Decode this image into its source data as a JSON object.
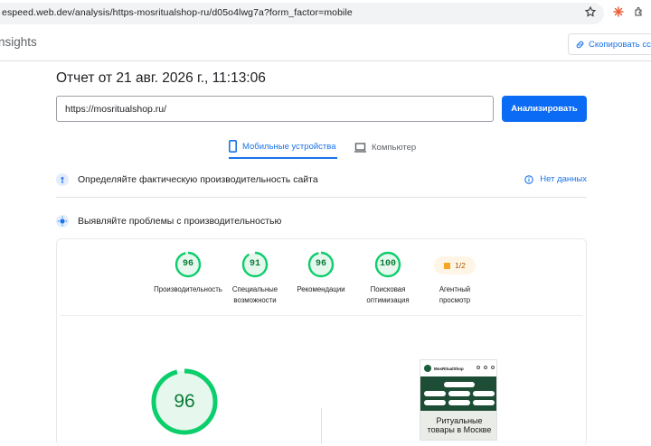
{
  "browser": {
    "url": "espeed.web.dev/analysis/https-mosritualshop-ru/d05o4lwg7a?form_factor=mobile"
  },
  "header": {
    "brand": "nsights",
    "copy_link_label": "Скопировать ссыл"
  },
  "report": {
    "title": "Отчет от 21 авг. 2026 г., 11:13:06",
    "url_value": "https://mosritualshop.ru/",
    "analyze_label": "Анализировать"
  },
  "tabs": [
    {
      "label": "Мобильные устройства",
      "active": true
    },
    {
      "label": "Компьютер",
      "active": false
    }
  ],
  "field_data": {
    "title": "Определяйте фактическую производительность сайта",
    "status": "Нет данных"
  },
  "lab_data": {
    "title": "Выявляйте проблемы с производительностью"
  },
  "scores": [
    {
      "value": "96",
      "label_line1": "Производительность",
      "label_line2": "",
      "fraction": 0.96
    },
    {
      "value": "91",
      "label_line1": "Специальные",
      "label_line2": "возможности",
      "fraction": 0.91
    },
    {
      "value": "96",
      "label_line1": "Рекомендации",
      "label_line2": "",
      "fraction": 0.96
    },
    {
      "value": "100",
      "label_line1": "Поисковая",
      "label_line2": "оптимизация",
      "fraction": 1.0
    }
  ],
  "pwa": {
    "value": "1/2",
    "label_line1": "Агентный",
    "label_line2": "просмотр"
  },
  "main_score": {
    "value": "96",
    "fraction": 0.96
  },
  "preview": {
    "site_name": "MosRitualShop",
    "headline_line1": "Ритуальные",
    "headline_line2": "товары в Москве"
  },
  "colors": {
    "pass": "#0cce6b",
    "pass_text": "#0a7a35",
    "accent": "#1a73e8",
    "button": "#0b6bf5",
    "average": "#f6a623"
  }
}
